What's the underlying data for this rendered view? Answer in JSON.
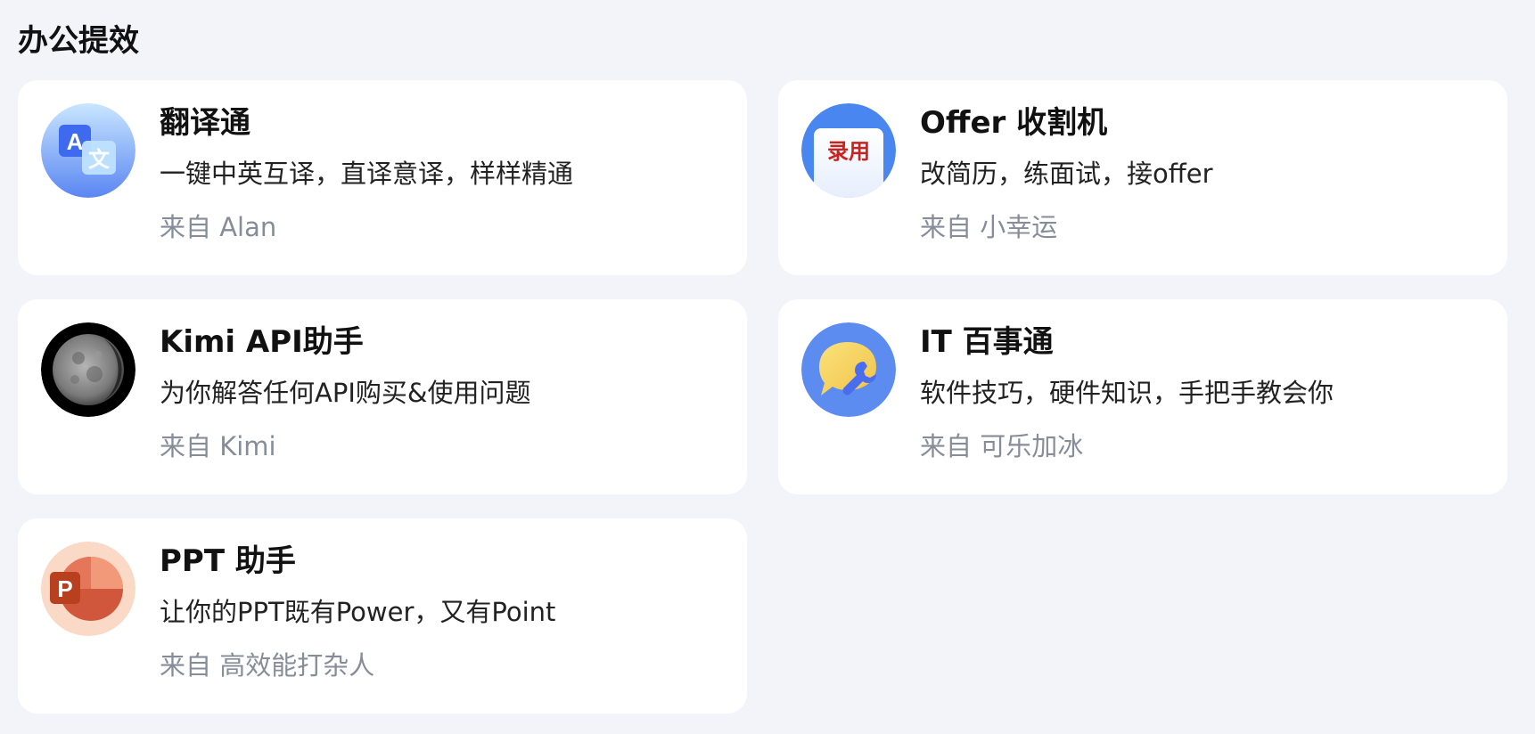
{
  "section": {
    "title": "办公提效"
  },
  "cards": [
    {
      "name": "翻译通",
      "desc": "一键中英互译，直译意译，样样精通",
      "from": "来自 Alan",
      "icon": "translate-icon",
      "icon_glyph_a": "A",
      "icon_glyph_b": "文",
      "colors": {
        "bg_top": "#c7e3ff",
        "bg_bottom": "#5d8bf4",
        "accent": "#3f6cf0"
      }
    },
    {
      "name": "Offer 收割机",
      "desc": "改简历，练面试，接offer",
      "from": "来自 小幸运",
      "icon": "offer-letter-icon",
      "icon_stamp": "录用",
      "colors": {
        "bg": "#4a86f0",
        "stamp": "#c8231f"
      }
    },
    {
      "name": "Kimi API助手",
      "desc": "为你解答任何API购买&使用问题",
      "from": "来自 Kimi",
      "icon": "moon-icon",
      "colors": {
        "bg": "#000000",
        "moon": "#8a8a8a"
      }
    },
    {
      "name": "IT 百事通",
      "desc": "软件技巧，硬件知识，手把手教会你",
      "from": "来自 可乐加冰",
      "icon": "wrench-chat-icon",
      "colors": {
        "bg": "#5d8cf0",
        "bubble": "#f5d76a",
        "wrench": "#4a6df0"
      }
    },
    {
      "name": "PPT 助手",
      "desc": "让你的PPT既有Power，又有Point",
      "from": "来自 高效能打杂人",
      "icon": "powerpoint-icon",
      "icon_letter": "P",
      "colors": {
        "bg": "#fad9c6",
        "main": "#d0573b",
        "light": "#f2997a"
      }
    }
  ]
}
